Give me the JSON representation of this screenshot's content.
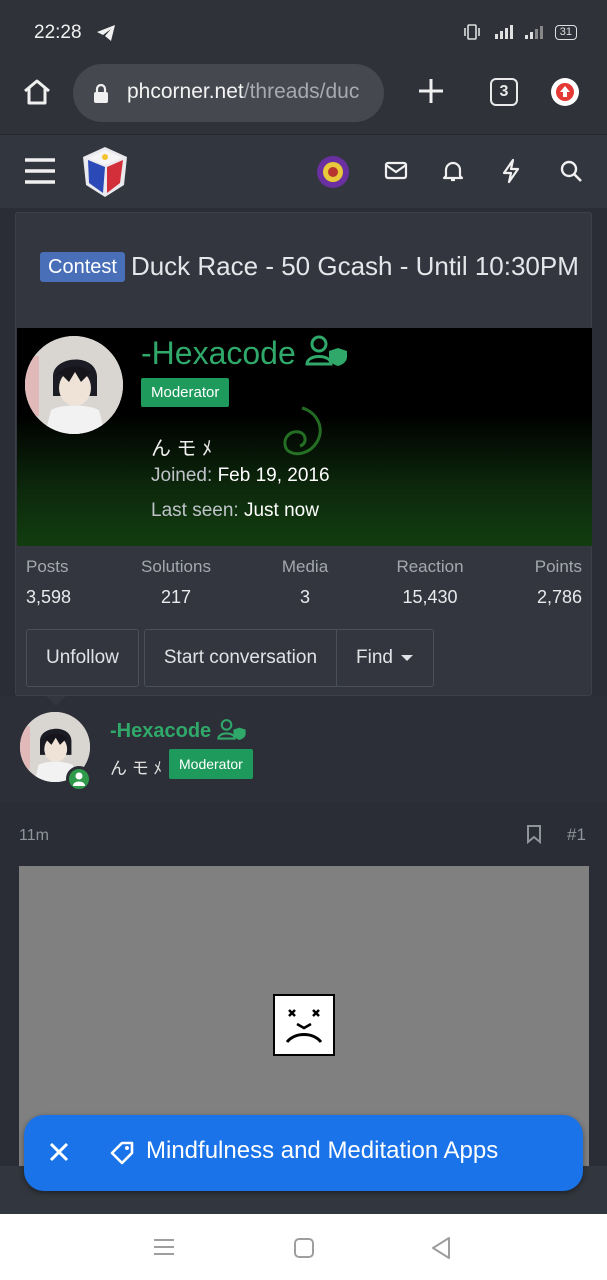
{
  "status_bar": {
    "time": "22:28",
    "battery": "31"
  },
  "browser": {
    "url_host": "phcorner.net",
    "url_path": "/threads/duc",
    "tab_count": "3"
  },
  "thread": {
    "prefix": "Contest",
    "title": "Duck Race - 50 Gcash - Until 10:30PM"
  },
  "member_card": {
    "username": "-Hexacode",
    "badge": "Moderator",
    "user_title": "ん モ ﾒ",
    "joined_label": "Joined:",
    "joined_value": "Feb 19, 2016",
    "last_seen_label": "Last seen:",
    "last_seen_value": "Just now",
    "stats": [
      {
        "label": "Posts",
        "value": "3,598"
      },
      {
        "label": "Solutions",
        "value": "217"
      },
      {
        "label": "Media",
        "value": "3"
      },
      {
        "label": "Reaction",
        "value": "15,430"
      },
      {
        "label": "Points",
        "value": "2,786"
      }
    ],
    "buttons": {
      "unfollow": "Unfollow",
      "start_conversation": "Start conversation",
      "find": "Find"
    }
  },
  "post": {
    "username": "-Hexacode",
    "user_title": "ん モ ﾒ",
    "badge": "Moderator",
    "time": "11m",
    "number": "#1"
  },
  "toast": {
    "text": "Mindfulness and Meditation Apps"
  },
  "colors": {
    "accent_green": "#2fa86a",
    "toast_blue": "#1a73e8",
    "prefix_blue": "#4a6fb9"
  }
}
